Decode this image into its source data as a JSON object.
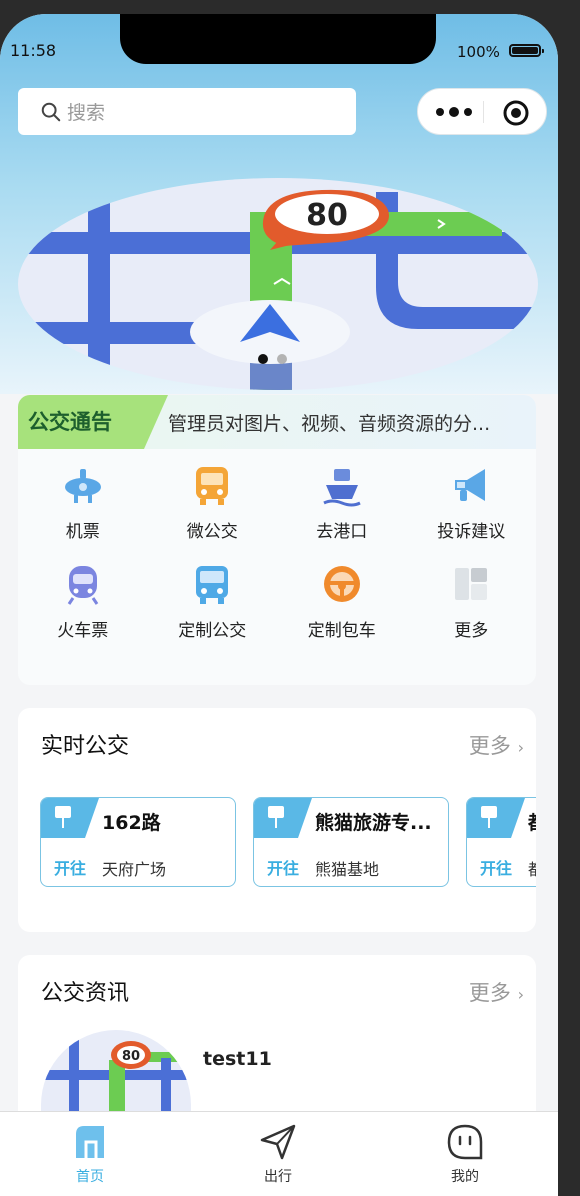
{
  "status_bar": {
    "time": "11:58",
    "battery": "100%"
  },
  "search": {
    "placeholder": "搜索"
  },
  "notice": {
    "tag": "公交通告",
    "text": "管理员对图片、视频、音频资源的分..."
  },
  "banner": {
    "sign": "80"
  },
  "quick_links": [
    {
      "label": "机票",
      "icon": "plane-icon"
    },
    {
      "label": "微公交",
      "icon": "bus-icon"
    },
    {
      "label": "去港口",
      "icon": "ship-icon"
    },
    {
      "label": "投诉建议",
      "icon": "megaphone-icon"
    },
    {
      "label": "火车票",
      "icon": "train-icon"
    },
    {
      "label": "定制公交",
      "icon": "custom-bus-icon"
    },
    {
      "label": "定制包车",
      "icon": "steering-wheel-icon"
    },
    {
      "label": "更多",
      "icon": "grid-icon"
    }
  ],
  "realtime_bus": {
    "title": "实时公交",
    "more": "更多",
    "routes": [
      {
        "name": "162路",
        "direction": "开往",
        "destination": "天府广场"
      },
      {
        "name": "熊猫旅游专...",
        "direction": "开往",
        "destination": "熊猫基地"
      },
      {
        "name": "都",
        "direction": "开往",
        "destination": "都"
      }
    ]
  },
  "news": {
    "title": "公交资讯",
    "more": "更多",
    "items": [
      {
        "title": "test11"
      }
    ]
  },
  "tabbar": [
    {
      "label": "首页",
      "icon": "home-icon"
    },
    {
      "label": "出行",
      "icon": "navigation-icon"
    },
    {
      "label": "我的",
      "icon": "profile-icon"
    }
  ],
  "colors": {
    "accent": "#3aaee0",
    "hero_top": "#6fbde6",
    "route_border": "#7bc4e3"
  }
}
